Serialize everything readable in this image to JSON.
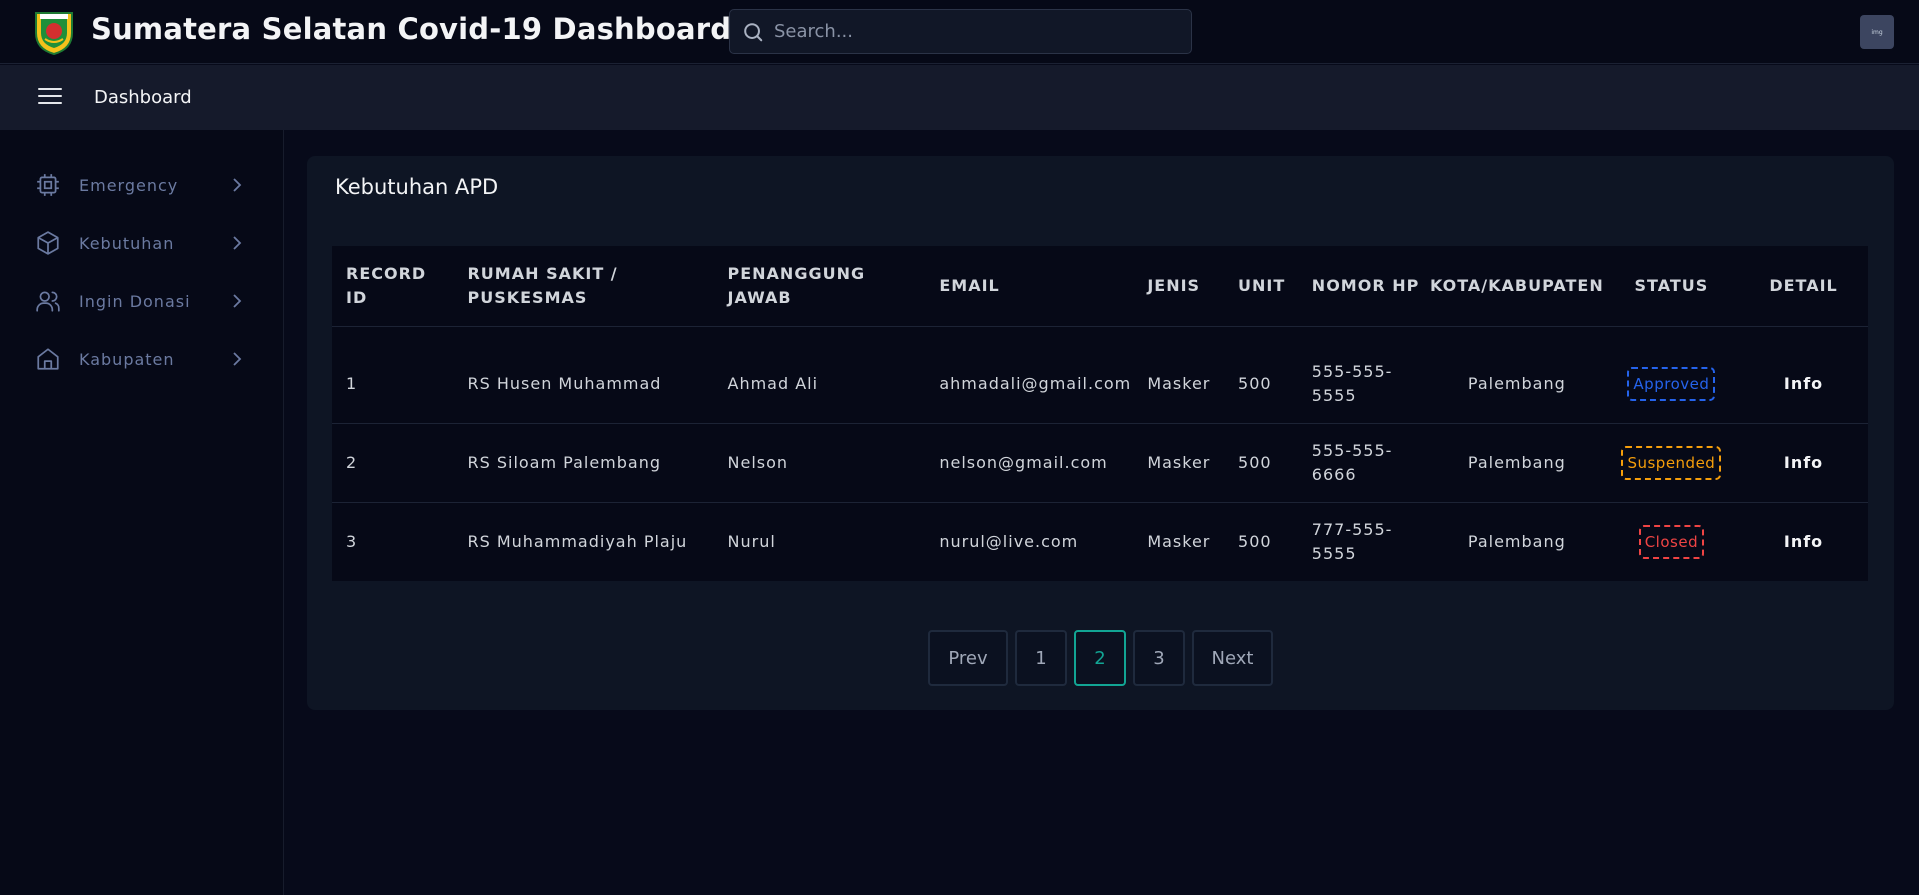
{
  "header": {
    "title": "Sumatera Selatan Covid-19 Dashboard",
    "search_placeholder": "Search...",
    "avatar_text": "img"
  },
  "subheader": {
    "breadcrumb": "Dashboard"
  },
  "sidebar": {
    "items": [
      {
        "label": "Emergency",
        "icon": "cpu-icon"
      },
      {
        "label": "Kebutuhan",
        "icon": "box-icon"
      },
      {
        "label": "Ingin Donasi",
        "icon": "users-icon"
      },
      {
        "label": "Kabupaten",
        "icon": "home-icon"
      }
    ]
  },
  "main": {
    "card_title": "Kebutuhan APD",
    "table": {
      "headers": {
        "record_id": "RECORD ID",
        "rumah_sakit": "RUMAH SAKIT / PUSKESMAS",
        "penanggung_jawab": "PENANGGUNG JAWAB",
        "email": "EMAIL",
        "jenis": "JENIS",
        "unit": "UNIT",
        "nomor_hp": "NOMOR HP",
        "kota": "KOTA/KABUPATEN",
        "status": "STATUS",
        "detail": "DETAIL"
      },
      "rows": [
        {
          "id": "1",
          "rs": "RS Husen Muhammad",
          "pj": "Ahmad Ali",
          "email": "ahmadali@gmail.com",
          "jenis": "Masker",
          "unit": "500",
          "hp": "555-555-5555",
          "kota": "Palembang",
          "status": "Approved",
          "detail": "Info"
        },
        {
          "id": "2",
          "rs": "RS Siloam Palembang",
          "pj": "Nelson",
          "email": "nelson@gmail.com",
          "jenis": "Masker",
          "unit": "500",
          "hp": "555-555-6666",
          "kota": "Palembang",
          "status": "Suspended",
          "detail": "Info"
        },
        {
          "id": "3",
          "rs": "RS Muhammadiyah Plaju",
          "pj": "Nurul",
          "email": "nurul@live.com",
          "jenis": "Masker",
          "unit": "500",
          "hp": "777-555-5555",
          "kota": "Palembang",
          "status": "Closed",
          "detail": "Info"
        }
      ]
    },
    "pagination": {
      "prev": "Prev",
      "pages": [
        "1",
        "2",
        "3"
      ],
      "current": "2",
      "next": "Next"
    }
  },
  "colors": {
    "approved": "#2563eb",
    "suspended": "#f59e0b",
    "closed": "#ef4444",
    "accent": "#12a594"
  }
}
